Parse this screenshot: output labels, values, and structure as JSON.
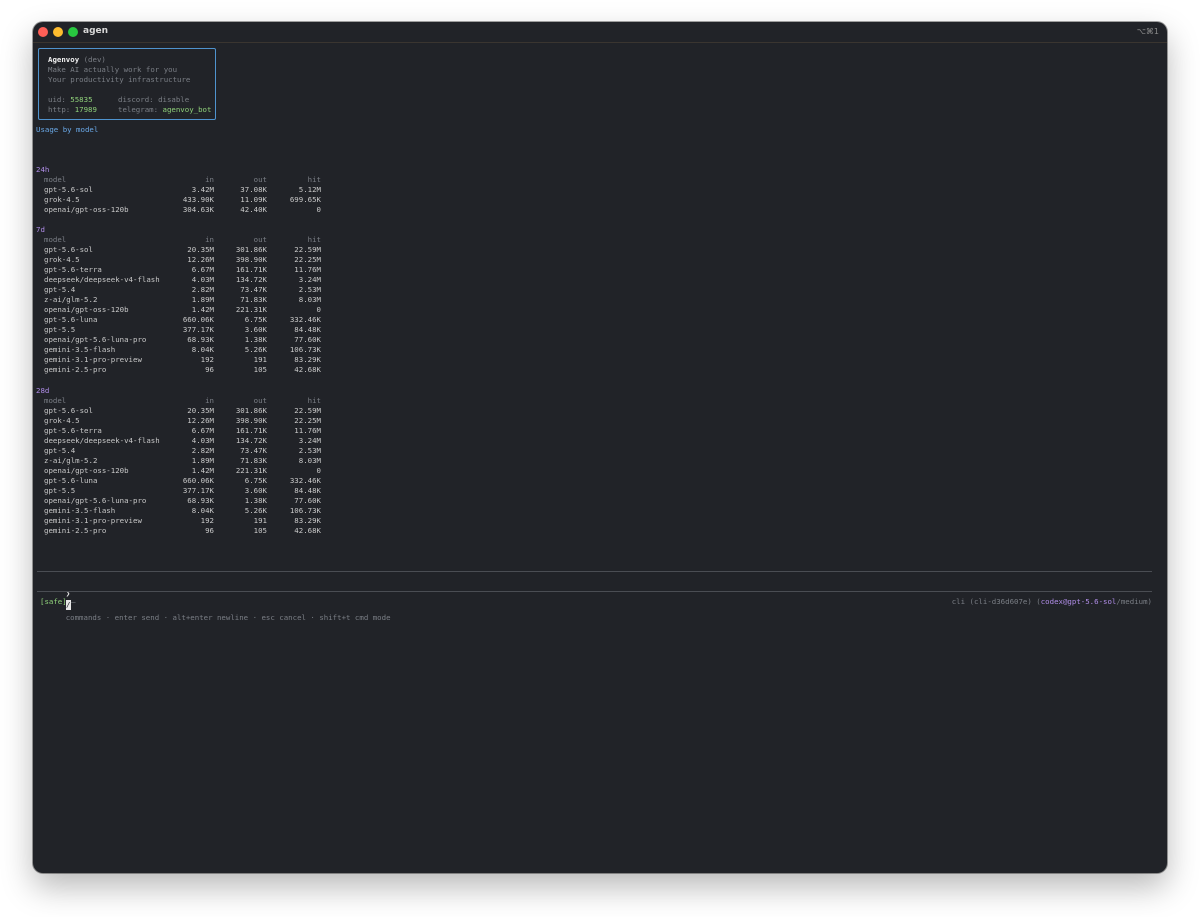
{
  "window": {
    "title": "agen",
    "shortcut": "⌥⌘1"
  },
  "banner": {
    "name": "Agenvoy",
    "tag": "(dev)",
    "tagline1": "Make AI actually work for you",
    "tagline2": "Your productivity infrastructure",
    "uid_label": "uid:",
    "uid_value": "55835",
    "discord_label": "discord:",
    "discord_value": "disable",
    "http_label": "http:",
    "http_value": "17989",
    "telegram_label": "telegram:",
    "telegram_value": "agenvoy_bot"
  },
  "usage_heading": "Usage by model",
  "columns": {
    "model": "model",
    "in": "in",
    "out": "out",
    "hit": "hit"
  },
  "sections": [
    {
      "label": "24h",
      "rows": [
        [
          "gpt-5.6-sol",
          "3.42M",
          "37.08K",
          "5.12M"
        ],
        [
          "grok-4.5",
          "433.90K",
          "11.09K",
          "699.65K"
        ],
        [
          "openai/gpt-oss-120b",
          "304.63K",
          "42.40K",
          "0"
        ]
      ]
    },
    {
      "label": "7d",
      "rows": [
        [
          "gpt-5.6-sol",
          "20.35M",
          "301.86K",
          "22.59M"
        ],
        [
          "grok-4.5",
          "12.26M",
          "398.90K",
          "22.25M"
        ],
        [
          "gpt-5.6-terra",
          "6.67M",
          "161.71K",
          "11.76M"
        ],
        [
          "deepseek/deepseek-v4-flash",
          "4.03M",
          "134.72K",
          "3.24M"
        ],
        [
          "gpt-5.4",
          "2.82M",
          "73.47K",
          "2.53M"
        ],
        [
          "z-ai/glm-5.2",
          "1.89M",
          "71.83K",
          "8.03M"
        ],
        [
          "openai/gpt-oss-120b",
          "1.42M",
          "221.31K",
          "0"
        ],
        [
          "gpt-5.6-luna",
          "660.06K",
          "6.75K",
          "332.46K"
        ],
        [
          "gpt-5.5",
          "377.17K",
          "3.60K",
          "84.48K"
        ],
        [
          "openai/gpt-5.6-luna-pro",
          "68.93K",
          "1.38K",
          "77.60K"
        ],
        [
          "gemini-3.5-flash",
          "8.04K",
          "5.26K",
          "106.73K"
        ],
        [
          "gemini-3.1-pro-preview",
          "192",
          "191",
          "83.29K"
        ],
        [
          "gemini-2.5-pro",
          "96",
          "105",
          "42.68K"
        ]
      ]
    },
    {
      "label": "28d",
      "rows": [
        [
          "gpt-5.6-sol",
          "20.35M",
          "301.86K",
          "22.59M"
        ],
        [
          "grok-4.5",
          "12.26M",
          "398.90K",
          "22.25M"
        ],
        [
          "gpt-5.6-terra",
          "6.67M",
          "161.71K",
          "11.76M"
        ],
        [
          "deepseek/deepseek-v4-flash",
          "4.03M",
          "134.72K",
          "3.24M"
        ],
        [
          "gpt-5.4",
          "2.82M",
          "73.47K",
          "2.53M"
        ],
        [
          "z-ai/glm-5.2",
          "1.89M",
          "71.83K",
          "8.03M"
        ],
        [
          "openai/gpt-oss-120b",
          "1.42M",
          "221.31K",
          "0"
        ],
        [
          "gpt-5.6-luna",
          "660.06K",
          "6.75K",
          "332.46K"
        ],
        [
          "gpt-5.5",
          "377.17K",
          "3.60K",
          "84.48K"
        ],
        [
          "openai/gpt-5.6-luna-pro",
          "68.93K",
          "1.38K",
          "77.60K"
        ],
        [
          "gemini-3.5-flash",
          "8.04K",
          "5.26K",
          "106.73K"
        ],
        [
          "gemini-3.1-pro-preview",
          "192",
          "191",
          "83.29K"
        ],
        [
          "gemini-2.5-pro",
          "96",
          "105",
          "42.68K"
        ]
      ]
    }
  ],
  "prompt": {
    "caret": "❯",
    "cursor_char": "/",
    "hint": "commands · enter send · alt+enter newline · esc cancel · shift+t cmd mode"
  },
  "status": {
    "mode": "[safe]",
    "dash": "–",
    "session": "cli (cli-d36d607e)",
    "open_paren": "(",
    "model": "codex@gpt-5.6-sol",
    "effort": "/medium)"
  }
}
